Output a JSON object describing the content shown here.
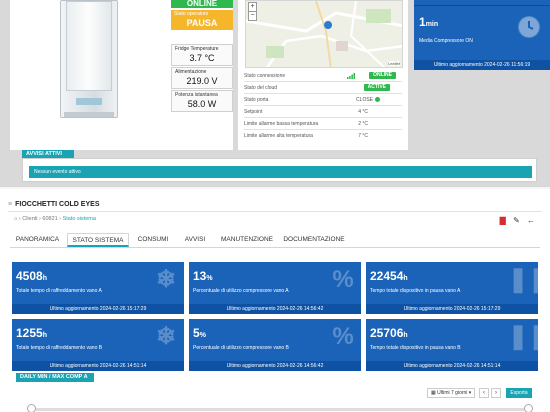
{
  "device": {
    "status_online": "ONLINE",
    "pause_label": "Stato operatore",
    "pause_value": "PAUSA",
    "metrics": [
      {
        "label": "Fridge Temperature",
        "value": "3.7 °C"
      },
      {
        "label": "Alimentazione",
        "value": "219.0 V"
      },
      {
        "label": "Potenza istantanea",
        "value": "58.0 W"
      }
    ]
  },
  "map": {
    "zoom_in": "+",
    "zoom_out": "−",
    "attribution": "Leaflet"
  },
  "status_rows": [
    {
      "label": "Stato connessione",
      "value": "ONLINE"
    },
    {
      "label": "Stato del cloud",
      "value": "ACTIVE"
    },
    {
      "label": "Stato porta",
      "value": "CLOSE"
    },
    {
      "label": "Setpoint",
      "value": "4 °C"
    },
    {
      "label": "Limite allarme bassa temperatura",
      "value": "2 °C"
    },
    {
      "label": "Limite allarme alta temperatura",
      "value": "7 °C"
    }
  ],
  "compressor_card": {
    "value": "1",
    "unit": "min",
    "desc": "Media Compressore ON",
    "foot": "Ultimo aggiornamento  2024-02-26 11:56:19"
  },
  "alarms": {
    "header": "AVVISI ATTIVI",
    "message": "Nessun evento attivo"
  },
  "section": {
    "title": "FIOCCHETTI COLD EYES",
    "breadcrumb": [
      "Clienti",
      "60821",
      "Stato sistema"
    ]
  },
  "tabs": [
    "PANORAMICA",
    "STATO SISTEMA",
    "CONSUMI",
    "AVVISI",
    "MANUTENZIONE",
    "DOCUMENTAZIONE"
  ],
  "stats": [
    {
      "value": "4508",
      "unit": "h",
      "desc": "Totale tempo di raffreddamento vano A",
      "foot": "Ultimo aggiornamento  2024-02-26 15:17:29",
      "icon": "❄"
    },
    {
      "value": "13",
      "unit": "%",
      "desc": "Percentuale di utilizzo compressore vano A",
      "foot": "Ultimo aggiornamento  2024-02-26 14:56:42",
      "icon": "%"
    },
    {
      "value": "22454",
      "unit": "h",
      "desc": "Tempo totale dispositivo in pausa vano A",
      "foot": "Ultimo aggiornamento  2024-02-26 15:17:29",
      "icon": "❚❚"
    },
    {
      "value": "1255",
      "unit": "h",
      "desc": "Totale tempo di raffreddamento vano B",
      "foot": "Ultimo aggiornamento  2024-02-26 14:51:14",
      "icon": "❄"
    },
    {
      "value": "5",
      "unit": "%",
      "desc": "Percentuale di utilizzo compressore vano B",
      "foot": "Ultimo aggiornamento  2024-02-26 14:56:42",
      "icon": "%"
    },
    {
      "value": "25706",
      "unit": "h",
      "desc": "Tempo totale dispositivo in pausa vano B",
      "foot": "Ultimo aggiornamento  2024-02-26 14:51:14",
      "icon": "❚❚"
    }
  ],
  "daily": {
    "header": "DAILY MIN / MAX COMP A",
    "range": "Ultimi 7 giorni",
    "prev": "‹",
    "next": "›",
    "export": "Esporta"
  }
}
